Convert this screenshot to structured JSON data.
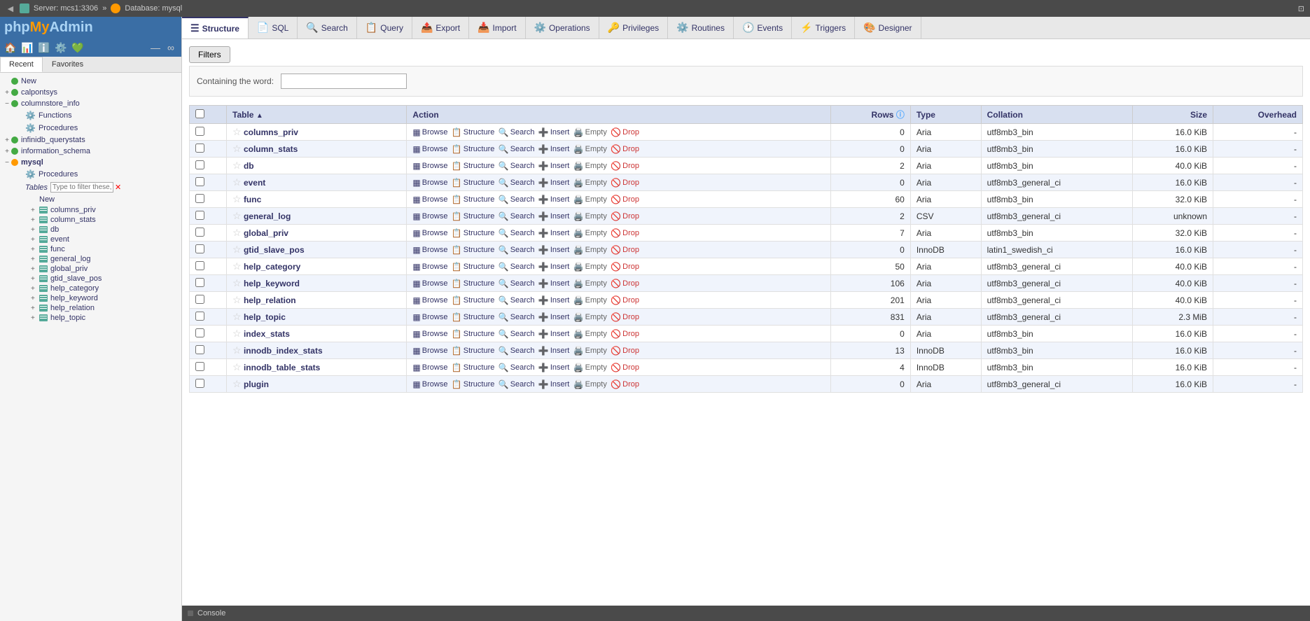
{
  "topbar": {
    "back_arrow": "◄",
    "server_label": "Server: mcs1:3306",
    "separator": "»",
    "db_label": "Database: mysql",
    "resize_icon": "⊡"
  },
  "sidebar": {
    "logo_php": "php",
    "logo_my": "My",
    "logo_admin": "Admin",
    "tabs": [
      "Recent",
      "Favorites"
    ],
    "icons": [
      "🏠",
      "📊",
      "ℹ️",
      "⚙️",
      "💚"
    ],
    "scroll_icons": [
      "—",
      "∞"
    ],
    "tree_items": [
      {
        "label": "New",
        "type": "new"
      },
      {
        "label": "calpontsys",
        "type": "db"
      },
      {
        "label": "columnstore_info",
        "type": "db",
        "expanded": true
      },
      {
        "label": "Functions",
        "type": "func"
      },
      {
        "label": "Procedures",
        "type": "func"
      },
      {
        "label": "infinidb_querystats",
        "type": "db"
      },
      {
        "label": "information_schema",
        "type": "db"
      },
      {
        "label": "mysql",
        "type": "db",
        "expanded": true,
        "active": true
      },
      {
        "label": "Procedures",
        "type": "func_sub"
      },
      {
        "label": "Tables",
        "type": "tables_header"
      },
      {
        "label": "New",
        "type": "table_new"
      }
    ],
    "mysql_tables": [
      "columns_priv",
      "column_stats",
      "db",
      "event",
      "func",
      "general_log",
      "global_priv",
      "gtid_slave_pos",
      "help_category",
      "help_keyword",
      "help_relation",
      "help_topic"
    ],
    "filter_placeholder": "Type to filter these, E",
    "console_label": "Console"
  },
  "tabs": [
    {
      "label": "Structure",
      "icon": "☰",
      "active": true
    },
    {
      "label": "SQL",
      "icon": "📄"
    },
    {
      "label": "Search",
      "icon": "🔍"
    },
    {
      "label": "Query",
      "icon": "📋"
    },
    {
      "label": "Export",
      "icon": "📤"
    },
    {
      "label": "Import",
      "icon": "📥"
    },
    {
      "label": "Operations",
      "icon": "⚙️"
    },
    {
      "label": "Privileges",
      "icon": "🔑"
    },
    {
      "label": "Routines",
      "icon": "⚙️"
    },
    {
      "label": "Events",
      "icon": "🕐"
    },
    {
      "label": "Triggers",
      "icon": "⚡"
    },
    {
      "label": "Designer",
      "icon": "🎨"
    }
  ],
  "filters": {
    "button_label": "Filters",
    "containing_label": "Containing the word:",
    "input_placeholder": ""
  },
  "table_headers": {
    "checkbox": "",
    "table": "Table",
    "action": "Action",
    "rows": "Rows",
    "type": "Type",
    "collation": "Collation",
    "size": "Size",
    "overhead": "Overhead"
  },
  "tables": [
    {
      "name": "columns_priv",
      "rows": 0,
      "type": "Aria",
      "collation": "utf8mb3_bin",
      "size": "16.0 KiB",
      "overhead": "-"
    },
    {
      "name": "column_stats",
      "rows": 0,
      "type": "Aria",
      "collation": "utf8mb3_bin",
      "size": "16.0 KiB",
      "overhead": "-"
    },
    {
      "name": "db",
      "rows": 2,
      "type": "Aria",
      "collation": "utf8mb3_bin",
      "size": "40.0 KiB",
      "overhead": "-"
    },
    {
      "name": "event",
      "rows": 0,
      "type": "Aria",
      "collation": "utf8mb3_general_ci",
      "size": "16.0 KiB",
      "overhead": "-"
    },
    {
      "name": "func",
      "rows": 60,
      "type": "Aria",
      "collation": "utf8mb3_bin",
      "size": "32.0 KiB",
      "overhead": "-"
    },
    {
      "name": "general_log",
      "rows": 2,
      "type": "CSV",
      "collation": "utf8mb3_general_ci",
      "size": "unknown",
      "overhead": "-"
    },
    {
      "name": "global_priv",
      "rows": 7,
      "type": "Aria",
      "collation": "utf8mb3_bin",
      "size": "32.0 KiB",
      "overhead": "-"
    },
    {
      "name": "gtid_slave_pos",
      "rows": 0,
      "type": "InnoDB",
      "collation": "latin1_swedish_ci",
      "size": "16.0 KiB",
      "overhead": "-"
    },
    {
      "name": "help_category",
      "rows": 50,
      "type": "Aria",
      "collation": "utf8mb3_general_ci",
      "size": "40.0 KiB",
      "overhead": "-"
    },
    {
      "name": "help_keyword",
      "rows": 106,
      "type": "Aria",
      "collation": "utf8mb3_general_ci",
      "size": "40.0 KiB",
      "overhead": "-"
    },
    {
      "name": "help_relation",
      "rows": 201,
      "type": "Aria",
      "collation": "utf8mb3_general_ci",
      "size": "40.0 KiB",
      "overhead": "-"
    },
    {
      "name": "help_topic",
      "rows": 831,
      "type": "Aria",
      "collation": "utf8mb3_general_ci",
      "size": "2.3 MiB",
      "overhead": "-"
    },
    {
      "name": "index_stats",
      "rows": 0,
      "type": "Aria",
      "collation": "utf8mb3_bin",
      "size": "16.0 KiB",
      "overhead": "-"
    },
    {
      "name": "innodb_index_stats",
      "rows": 13,
      "type": "InnoDB",
      "collation": "utf8mb3_bin",
      "size": "16.0 KiB",
      "overhead": "-"
    },
    {
      "name": "innodb_table_stats",
      "rows": 4,
      "type": "InnoDB",
      "collation": "utf8mb3_bin",
      "size": "16.0 KiB",
      "overhead": "-"
    },
    {
      "name": "plugin",
      "rows": 0,
      "type": "Aria",
      "collation": "utf8mb3_general_ci",
      "size": "16.0 KiB",
      "overhead": "-"
    }
  ],
  "actions": {
    "browse": "Browse",
    "structure": "Structure",
    "search": "Search",
    "insert": "Insert",
    "empty": "Empty",
    "drop": "Drop"
  }
}
